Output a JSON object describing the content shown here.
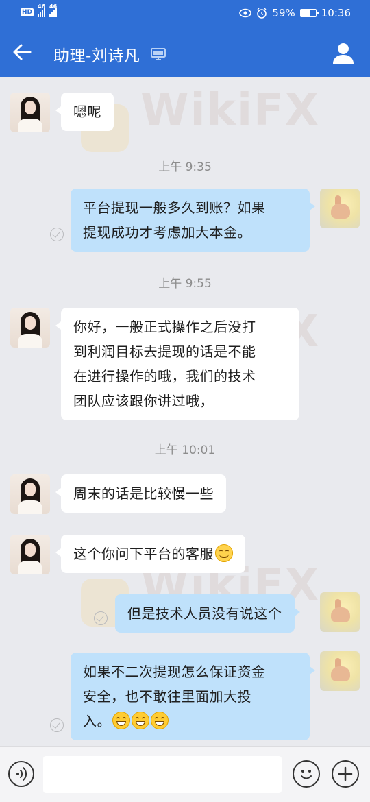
{
  "status_bar": {
    "left_badge": "HD",
    "signal1_label": "46",
    "signal2_label": "46",
    "battery_percent": "59%",
    "battery_level": 0.59,
    "time": "10:36"
  },
  "header": {
    "title": "助理-刘诗凡"
  },
  "watermark": {
    "text": "WikiFX"
  },
  "messages": [
    {
      "side": "in",
      "text": "嗯呢"
    },
    {
      "type": "time",
      "text": "上午 9:35"
    },
    {
      "side": "out",
      "lines": [
        "平台提现一般多久到账？如果",
        "提现成功才考虑加大本金。"
      ]
    },
    {
      "type": "time",
      "text": "上午 9:55"
    },
    {
      "side": "in",
      "lines": [
        "你好，一般正式操作之后没打",
        "到利润目标去提现的话是不能",
        "在进行操作的哦，我们的技术",
        "团队应该跟你讲过哦，"
      ]
    },
    {
      "type": "time",
      "text": "上午 10:01"
    },
    {
      "side": "in",
      "text": "周末的话是比较慢一些"
    },
    {
      "side": "in",
      "text": "这个你问下平台的客服",
      "emoji": "smiling-face"
    },
    {
      "side": "out",
      "text": "但是技术人员没有说这个"
    },
    {
      "side": "out",
      "lines": [
        "如果不二次提现怎么保证资金",
        "安全，也不敢往里面加大投",
        "入。"
      ],
      "emoji": "grinning-face x3"
    }
  ],
  "input_bar": {
    "placeholder": ""
  }
}
